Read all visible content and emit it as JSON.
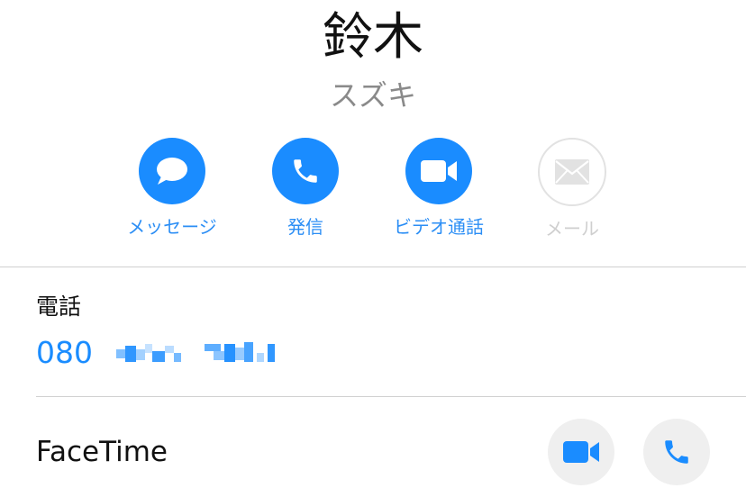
{
  "contact": {
    "name": "鈴木",
    "phonetic": "スズキ"
  },
  "actions": [
    {
      "label": "メッセージ",
      "icon": "message-bubble-icon",
      "enabled": true
    },
    {
      "label": "発信",
      "icon": "phone-icon",
      "enabled": true
    },
    {
      "label": "ビデオ通話",
      "icon": "video-camera-icon",
      "enabled": true
    },
    {
      "label": "メール",
      "icon": "mail-envelope-icon",
      "enabled": false
    }
  ],
  "phone": {
    "label": "電話",
    "number_prefix": "080",
    "number_redacted": true
  },
  "facetime": {
    "label": "FaceTime",
    "video_icon": "video-camera-icon",
    "audio_icon": "phone-icon"
  },
  "colors": {
    "accent": "#1a8cff",
    "label_blue": "#2b8ef5",
    "disabled": "#cfcfcf",
    "facetime_button_bg": "#efefef"
  }
}
